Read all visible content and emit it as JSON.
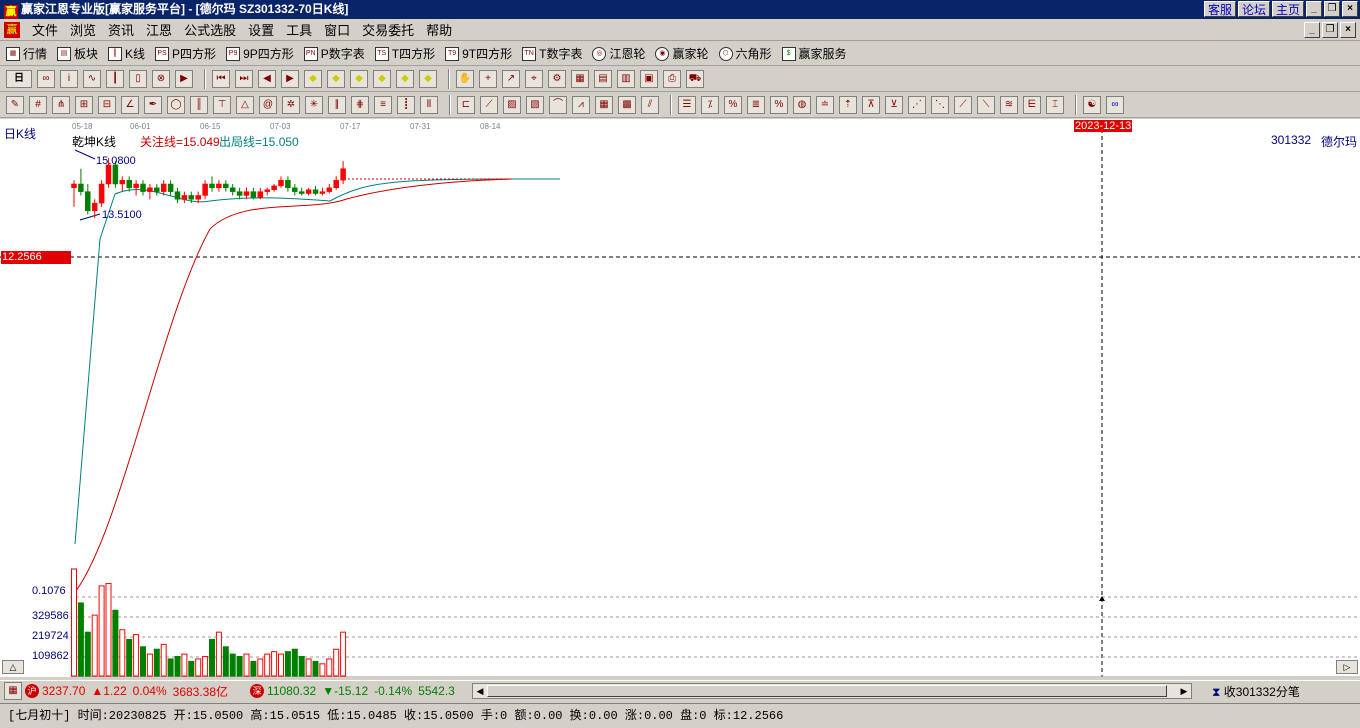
{
  "window": {
    "title": "赢家江恩专业版[赢家服务平台] - [德尔玛  SZ301332-70日K线]",
    "logo_char": "赢",
    "links": [
      "客服",
      "论坛",
      "主页"
    ]
  },
  "menu": {
    "items": [
      "文件",
      "浏览",
      "资讯",
      "江恩",
      "公式选股",
      "设置",
      "工具",
      "窗口",
      "交易委托",
      "帮助"
    ]
  },
  "toolbar1": {
    "items": [
      {
        "label": "行情",
        "icon": "grid-icon"
      },
      {
        "label": "板块",
        "icon": "blocks-icon"
      },
      {
        "label": "K线",
        "icon": "candles-icon"
      },
      {
        "label": "P四方形",
        "icon": "ps-icon",
        "badge": "PS"
      },
      {
        "label": "9P四方形",
        "icon": "p9-icon",
        "badge": "P9"
      },
      {
        "label": "P数字表",
        "icon": "pn-icon",
        "badge": "PN"
      },
      {
        "label": "T四方形",
        "icon": "ts-icon",
        "badge": "TS"
      },
      {
        "label": "9T四方形",
        "icon": "t9-icon",
        "badge": "T9"
      },
      {
        "label": "T数字表",
        "icon": "tn-icon",
        "badge": "TN"
      },
      {
        "label": "江恩轮",
        "icon": "gann-wheel-icon"
      },
      {
        "label": "赢家轮",
        "icon": "winner-wheel-icon"
      },
      {
        "label": "六角形",
        "icon": "hexagon-icon"
      },
      {
        "label": "赢家服务",
        "icon": "dollar-icon"
      }
    ],
    "period_select": "日"
  },
  "chart": {
    "period_label": "日K线",
    "indicator_name": "乾坤K线",
    "focus_line_label": "关注线=15.049",
    "exit_line_label": "出局线=15.050",
    "high_label": "15.0800",
    "low_label": "13.5100",
    "cursor_price": "12.2566",
    "cursor_date": "2023-12-13",
    "stock_code": "301332",
    "stock_name": "德尔玛",
    "dates": [
      "05-18",
      "06-01",
      "06-15",
      "07-03",
      "07-17",
      "07-31",
      "08-14"
    ],
    "volume_labels": [
      "0.1076",
      "329586",
      "219724",
      "109862"
    ],
    "colors": {
      "up": "#ff0000",
      "down": "#008000",
      "focus_line": "#cc0000",
      "exit_line": "#008080",
      "cursor": "#000000"
    }
  },
  "chart_data": {
    "type": "candlestick",
    "candles": [
      {
        "o": 14.3,
        "h": 14.5,
        "l": 13.8,
        "c": 14.4
      },
      {
        "o": 14.4,
        "h": 14.8,
        "l": 14.1,
        "c": 14.2
      },
      {
        "o": 14.2,
        "h": 14.4,
        "l": 13.6,
        "c": 13.7
      },
      {
        "o": 13.7,
        "h": 14.0,
        "l": 13.51,
        "c": 13.9
      },
      {
        "o": 13.9,
        "h": 14.5,
        "l": 13.8,
        "c": 14.4
      },
      {
        "o": 14.4,
        "h": 15.08,
        "l": 14.3,
        "c": 14.9
      },
      {
        "o": 14.9,
        "h": 15.0,
        "l": 14.3,
        "c": 14.4
      },
      {
        "o": 14.4,
        "h": 14.6,
        "l": 14.2,
        "c": 14.5
      },
      {
        "o": 14.5,
        "h": 14.6,
        "l": 14.2,
        "c": 14.3
      },
      {
        "o": 14.3,
        "h": 14.5,
        "l": 14.1,
        "c": 14.4
      },
      {
        "o": 14.4,
        "h": 14.5,
        "l": 14.1,
        "c": 14.2
      },
      {
        "o": 14.2,
        "h": 14.4,
        "l": 14.0,
        "c": 14.3
      },
      {
        "o": 14.3,
        "h": 14.4,
        "l": 14.1,
        "c": 14.2
      },
      {
        "o": 14.2,
        "h": 14.5,
        "l": 14.1,
        "c": 14.4
      },
      {
        "o": 14.4,
        "h": 14.5,
        "l": 14.1,
        "c": 14.2
      },
      {
        "o": 14.2,
        "h": 14.3,
        "l": 13.9,
        "c": 14.0
      },
      {
        "o": 14.0,
        "h": 14.2,
        "l": 13.9,
        "c": 14.1
      },
      {
        "o": 14.1,
        "h": 14.2,
        "l": 13.9,
        "c": 14.0
      },
      {
        "o": 14.0,
        "h": 14.2,
        "l": 13.9,
        "c": 14.1
      },
      {
        "o": 14.1,
        "h": 14.5,
        "l": 14.0,
        "c": 14.4
      },
      {
        "o": 14.4,
        "h": 14.6,
        "l": 14.2,
        "c": 14.3
      },
      {
        "o": 14.3,
        "h": 14.5,
        "l": 14.2,
        "c": 14.4
      },
      {
        "o": 14.4,
        "h": 14.5,
        "l": 14.2,
        "c": 14.3
      },
      {
        "o": 14.3,
        "h": 14.4,
        "l": 14.1,
        "c": 14.2
      },
      {
        "o": 14.2,
        "h": 14.3,
        "l": 14.0,
        "c": 14.1
      },
      {
        "o": 14.1,
        "h": 14.3,
        "l": 14.0,
        "c": 14.2
      },
      {
        "o": 14.2,
        "h": 14.3,
        "l": 14.0,
        "c": 14.05
      },
      {
        "o": 14.05,
        "h": 14.3,
        "l": 14.0,
        "c": 14.2
      },
      {
        "o": 14.2,
        "h": 14.3,
        "l": 14.1,
        "c": 14.25
      },
      {
        "o": 14.25,
        "h": 14.4,
        "l": 14.2,
        "c": 14.35
      },
      {
        "o": 14.35,
        "h": 14.6,
        "l": 14.3,
        "c": 14.5
      },
      {
        "o": 14.5,
        "h": 14.6,
        "l": 14.2,
        "c": 14.3
      },
      {
        "o": 14.3,
        "h": 14.4,
        "l": 14.1,
        "c": 14.2
      },
      {
        "o": 14.2,
        "h": 14.3,
        "l": 14.1,
        "c": 14.15
      },
      {
        "o": 14.15,
        "h": 14.3,
        "l": 14.1,
        "c": 14.25
      },
      {
        "o": 14.25,
        "h": 14.35,
        "l": 14.1,
        "c": 14.15
      },
      {
        "o": 14.15,
        "h": 14.3,
        "l": 14.1,
        "c": 14.2
      },
      {
        "o": 14.2,
        "h": 14.4,
        "l": 14.15,
        "c": 14.3
      },
      {
        "o": 14.3,
        "h": 14.6,
        "l": 14.25,
        "c": 14.5
      },
      {
        "o": 14.5,
        "h": 15.0,
        "l": 14.4,
        "c": 14.8
      }
    ],
    "volume_max": 439448,
    "volumes": [
      439448,
      300000,
      180000,
      250000,
      370000,
      380000,
      270000,
      190000,
      150000,
      170000,
      120000,
      90000,
      110000,
      130000,
      70000,
      80000,
      90000,
      60000,
      70000,
      80000,
      150000,
      180000,
      120000,
      90000,
      80000,
      90000,
      60000,
      70000,
      90000,
      100000,
      90000,
      100000,
      110000,
      80000,
      70000,
      60000,
      50000,
      70000,
      110000,
      180000
    ]
  },
  "status": {
    "sh_index": "3237.70",
    "sh_change": "▲1.22",
    "sh_pct": "0.04%",
    "sh_amount": "3683.38亿",
    "sz_index": "11080.32",
    "sz_change": "▼-15.12",
    "sz_pct": "-0.14%",
    "sz_amount": "5542.3",
    "tick_label": "收301332分笔"
  },
  "info": {
    "text": "[七月初十] 时间:20230825 开:15.0500 高:15.0515 低:15.0485 收:15.0500 手:0 额:0.00 换:0.00 涨:0.00 盘:0 标:12.2566"
  }
}
